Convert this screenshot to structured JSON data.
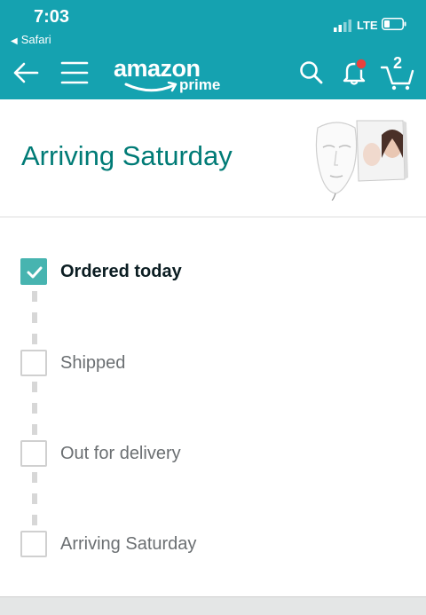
{
  "status_bar": {
    "time": "7:03",
    "back_app": "Safari",
    "network": "LTE",
    "icons": [
      "signal-bars-icon",
      "battery-icon",
      "back-triangle-icon"
    ]
  },
  "nav": {
    "logo_text": "amazon",
    "logo_sub": "prime",
    "cart_count": "2",
    "icons": [
      "back-arrow-icon",
      "menu-icon",
      "search-icon",
      "notifications-bell-icon",
      "cart-icon"
    ],
    "accent_color": "#15a2b0",
    "notification_dot_color": "#e8413c"
  },
  "shipment": {
    "title": "Arriving Saturday",
    "title_color": "#007b76",
    "product_image": "led-face-mask-product-icon"
  },
  "tracking": {
    "steps": [
      {
        "label": "Ordered today",
        "done": true
      },
      {
        "label": "Shipped",
        "done": false
      },
      {
        "label": "Out for delivery",
        "done": false
      },
      {
        "label": "Arriving Saturday",
        "done": false
      }
    ],
    "checked_color": "#47b4b0"
  }
}
